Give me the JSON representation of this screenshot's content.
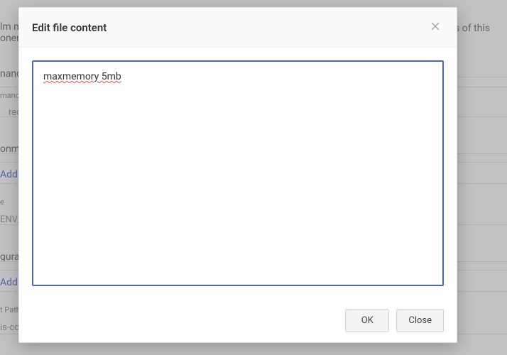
{
  "modal": {
    "title": "Edit file content",
    "content": "maxmemory 5mb",
    "ok_label": "OK",
    "close_label": "Close"
  },
  "background": {
    "topline_prefix": "lm m",
    "topline_suffix": "onent",
    "topright_text": "iles of this",
    "section_mand": "nand",
    "small_mand": "mand",
    "input_red": "red",
    "section_onme": "onme",
    "add_label": "Add",
    "small_e": "e",
    "env_text": "ENV_",
    "section_gura": "gura",
    "small_tpath": "t Path",
    "isco_text": "is-co"
  }
}
